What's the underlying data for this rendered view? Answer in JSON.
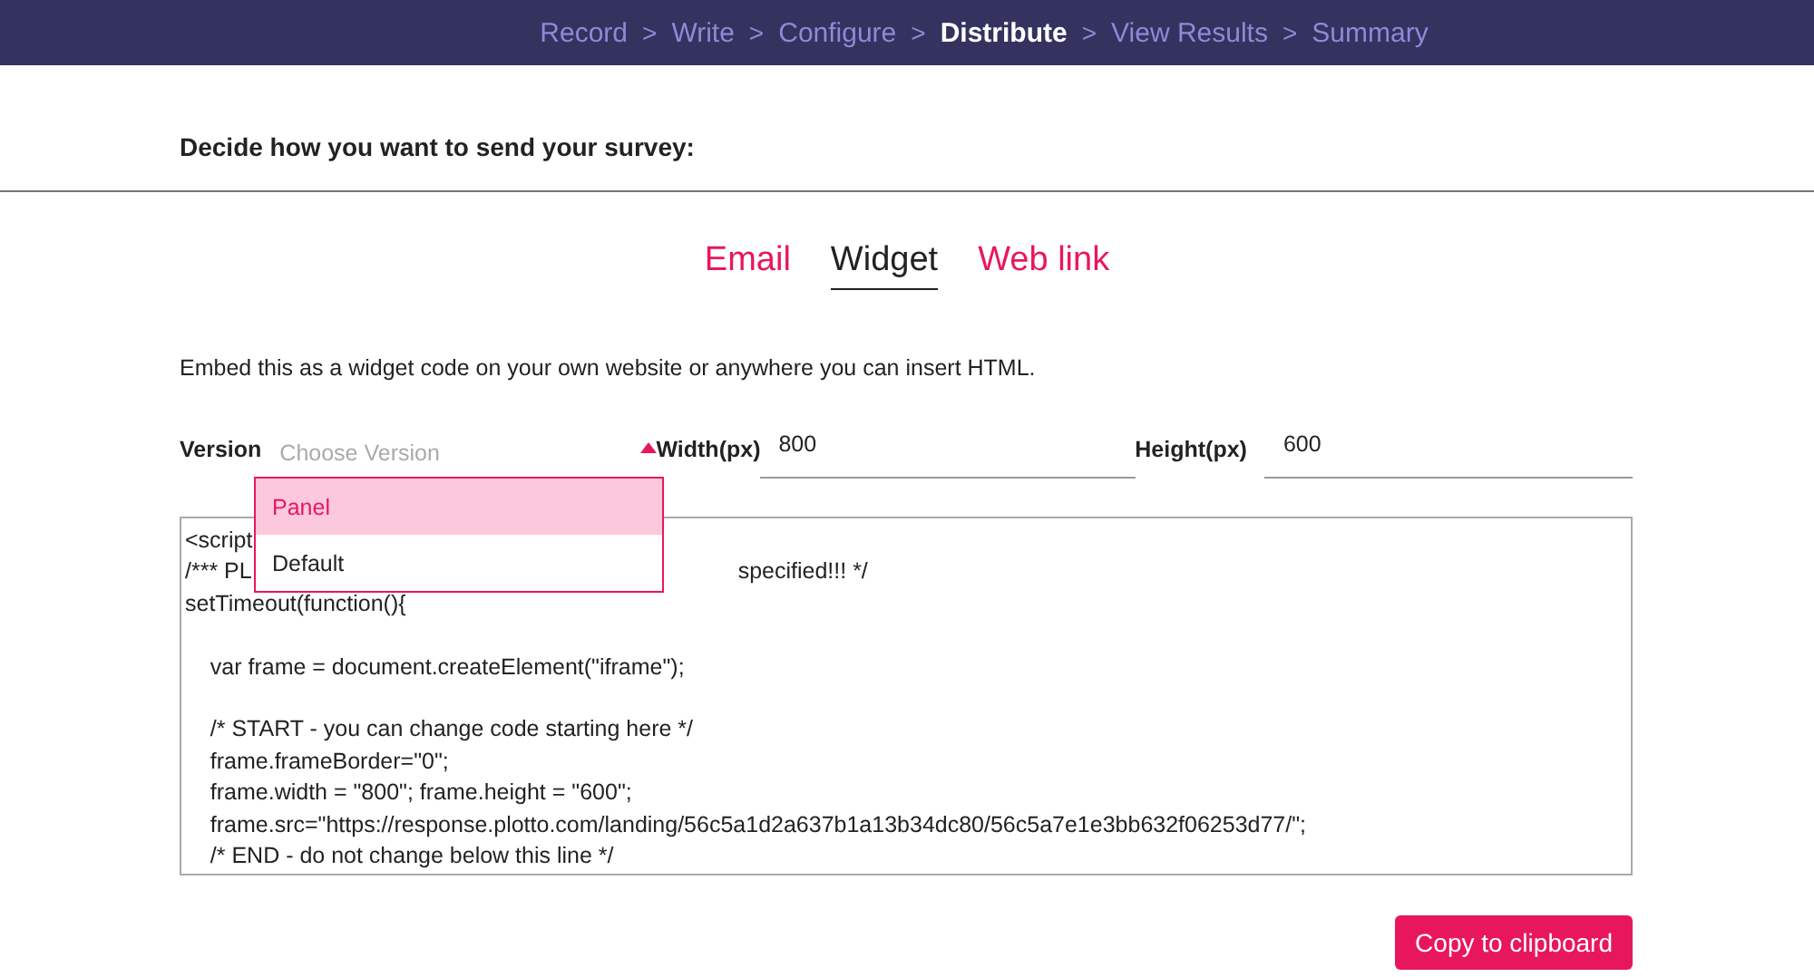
{
  "steps": [
    {
      "label": "Record",
      "selected": false
    },
    {
      "label": "Write",
      "selected": false
    },
    {
      "label": "Configure",
      "selected": false
    },
    {
      "label": "Distribute",
      "selected": true
    },
    {
      "label": "View Results",
      "selected": false
    },
    {
      "label": "Summary",
      "selected": false
    }
  ],
  "separator": ">",
  "heading": "Decide how you want to send your survey:",
  "tabs": [
    {
      "label": "Email",
      "selected": false
    },
    {
      "label": "Widget",
      "selected": true
    },
    {
      "label": "Web link",
      "selected": false
    }
  ],
  "description": "Embed this as a widget code on your own website or anywhere you can insert HTML.",
  "version": {
    "label": "Version",
    "placeholder": "Choose Version",
    "expanded": true,
    "options": [
      {
        "label": "Panel",
        "selected": true
      },
      {
        "label": "Default",
        "selected": false
      }
    ]
  },
  "width": {
    "label": "Width(px)",
    "value": "800"
  },
  "height": {
    "label": "Height(px)",
    "value": "600"
  },
  "code_lines": [
    {
      "parts": [
        "<script"
      ]
    },
    {
      "parts": [
        "/*** PL",
        "specified!!! */"
      ]
    },
    {
      "parts": [
        "setTimeout(function(){"
      ]
    },
    {
      "gap_before": true,
      "parts": [
        "    var frame = document.createElement(\"iframe\");"
      ]
    },
    {
      "gap_before": true,
      "parts": [
        "    /* START - you can change code starting here */"
      ]
    },
    {
      "parts": [
        "    frame.frameBorder=\"0\";"
      ]
    },
    {
      "parts": [
        "    frame.width = \"800\"; frame.height = \"600\";"
      ]
    },
    {
      "parts": [
        "    frame.src=\"https://response.plotto.com/landing/56c5a1d2a637b1a13b34dc80/56c5a7e1e3bb632f06253d77/\";"
      ]
    },
    {
      "parts": [
        "    /* END - do not change below this line */"
      ]
    }
  ],
  "copy_button": "Copy to clipboard"
}
